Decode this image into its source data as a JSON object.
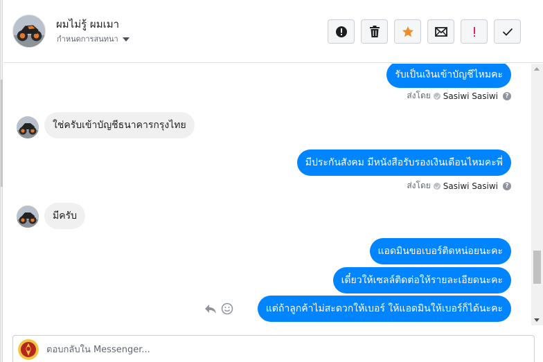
{
  "header": {
    "contact_name": "ผมไม่รู้ ผมเมา",
    "status_label": "กำหนดการสนทนา",
    "actions": [
      {
        "id": "spam",
        "icon": "exclamation-circle-icon",
        "color": "#1c1e21"
      },
      {
        "id": "delete",
        "icon": "trash-icon",
        "color": "#1c1e21"
      },
      {
        "id": "star",
        "icon": "star-icon",
        "color": "#f28b27"
      },
      {
        "id": "unread",
        "icon": "envelope-icon",
        "color": "#1c1e21"
      },
      {
        "id": "priority",
        "icon": "exclamation-icon",
        "color": "#e0245e"
      },
      {
        "id": "done",
        "icon": "check-icon",
        "color": "#1c1e21"
      }
    ]
  },
  "messages": [
    {
      "dir": "out",
      "text": "รับเป็นเงินเข้าบัญชีไหมคะ"
    },
    {
      "dir": "meta",
      "label": "ส่งโดย",
      "sender": "Sasiwi Sasiwi"
    },
    {
      "dir": "in",
      "text": "ใช่ครับเข้าบัญชีธนาคารกรุงไทย"
    },
    {
      "dir": "out",
      "text": "มีประกันสังคม มีหนังสือรับรองเงินเดือนไหมคะพี่"
    },
    {
      "dir": "meta",
      "label": "ส่งโดย",
      "sender": "Sasiwi Sasiwi"
    },
    {
      "dir": "in",
      "text": "มีครับ"
    },
    {
      "dir": "out",
      "text": "แอดมินขอเบอร์ติดหน่อยนะคะ"
    },
    {
      "dir": "out",
      "text": "เดี๋ยวให้เซลล์ติดต่อให้รายละเอียดนะคะ"
    },
    {
      "dir": "out",
      "text": "แต่ถ้าลูกค้าไม่สะดวกให้เบอร์ ให้แอดมินให้เบอร์ก็ได้นะคะ"
    }
  ],
  "composer": {
    "placeholder": "ตอบกลับใน Messenger..."
  },
  "colors": {
    "outgoing_bubble": "#0084ff",
    "incoming_bubble": "#f1f0f0"
  }
}
